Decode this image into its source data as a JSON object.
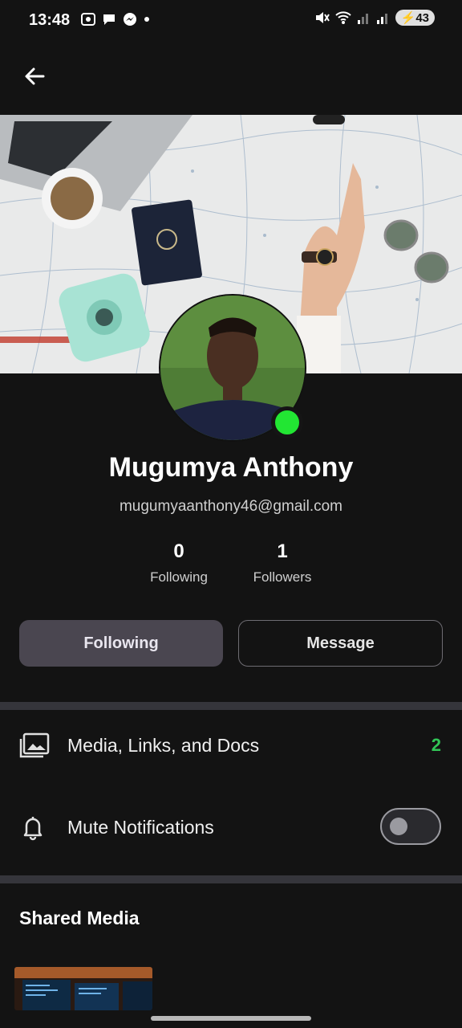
{
  "status_bar": {
    "time": "13:48",
    "battery": "43"
  },
  "profile": {
    "name": "Mugumya Anthony",
    "email": "mugumyaanthony46@gmail.com",
    "online_color": "#22e633",
    "stats": [
      {
        "value": "0",
        "label": "Following"
      },
      {
        "value": "1",
        "label": "Followers"
      }
    ]
  },
  "actions": {
    "following_label": "Following",
    "message_label": "Message"
  },
  "settings": {
    "media_label": "Media, Links, and Docs",
    "media_count": "2",
    "mute_label": "Mute Notifications",
    "mute_enabled": false
  },
  "shared_media": {
    "title": "Shared Media"
  },
  "colors": {
    "background": "#131313",
    "accent_green": "#31c556",
    "button_fill": "#4a4650"
  }
}
